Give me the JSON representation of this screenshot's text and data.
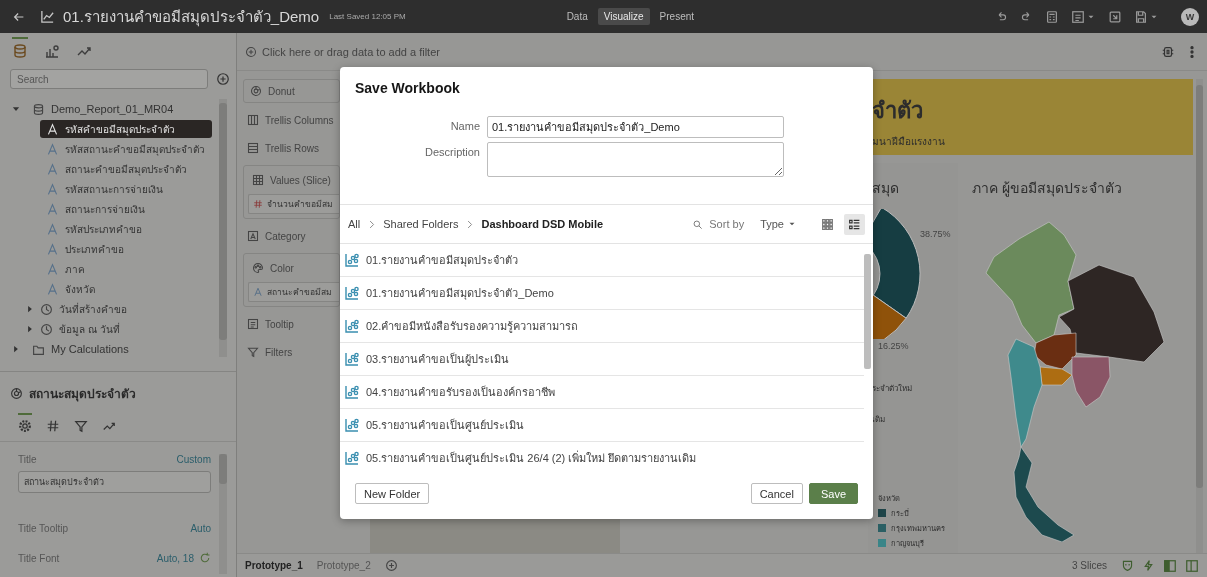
{
  "app_bar": {
    "title": "01.รายงานคำขอมีสมุดประจำตัว_Demo",
    "last_saved": "Last Saved 12:05 PM",
    "modes": [
      {
        "label": "Data",
        "selected": false
      },
      {
        "label": "Visualize",
        "selected": true
      },
      {
        "label": "Present",
        "selected": false
      }
    ],
    "avatar": "W"
  },
  "data_panel": {
    "tabs": [
      {
        "kind": "data",
        "selected": true
      },
      {
        "kind": "visualizations",
        "selected": false
      },
      {
        "kind": "analytics",
        "selected": false
      }
    ],
    "search": {
      "placeholder": "Search"
    },
    "tree": [
      {
        "label": "Demo_Report_01_MR04",
        "kind": "dataset",
        "expanded": true,
        "selected": false,
        "children": [
          {
            "label": "รหัสคำขอมีสมุดประจำตัว",
            "kind": "attribute",
            "selected": true
          },
          {
            "label": "รหัสสถานะคำขอมีสมุดประจำตัว",
            "kind": "attribute",
            "selected": false
          },
          {
            "label": "สถานะคำขอมีสมุดประจำตัว",
            "kind": "attribute",
            "selected": false
          },
          {
            "label": "รหัสสถานะการจ่ายเงิน",
            "kind": "attribute",
            "selected": false
          },
          {
            "label": "สถานะการจ่ายเงิน",
            "kind": "attribute",
            "selected": false
          },
          {
            "label": "รหัสประเภทคำขอ",
            "kind": "attribute",
            "selected": false
          },
          {
            "label": "ประเภทคำขอ",
            "kind": "attribute",
            "selected": false
          },
          {
            "label": "ภาค",
            "kind": "attribute",
            "selected": false
          },
          {
            "label": "จังหวัด",
            "kind": "attribute",
            "selected": false
          },
          {
            "label": "วันที่สร้างคำขอ",
            "kind": "date",
            "expanded": false,
            "selected": false
          },
          {
            "label": "ข้อมูล ณ วันที่",
            "kind": "date",
            "expanded": false,
            "selected": false
          }
        ]
      },
      {
        "label": "My Calculations",
        "kind": "folder",
        "expanded": false,
        "selected": false
      }
    ]
  },
  "properties": {
    "title": "สถานะสมุดประจำตัว",
    "tabs": [
      {
        "kind": "general",
        "selected": true
      },
      {
        "kind": "values",
        "selected": false
      },
      {
        "kind": "filters",
        "selected": false
      },
      {
        "kind": "analytics",
        "selected": false
      }
    ],
    "rows": [
      {
        "label": "Title",
        "value": "Custom",
        "kind": "field",
        "field_value": "สถานะสมุดประจำตัว"
      },
      {
        "label": "Title Tooltip",
        "value": "Auto",
        "kind": "plain"
      },
      {
        "label": "Title Font",
        "value": "Auto, 18",
        "kind": "reset"
      }
    ]
  },
  "filter_bar": {
    "placeholder": "Click here or drag data to add a filter"
  },
  "grammar": [
    {
      "label": "Donut",
      "kind": "chart_type"
    },
    {
      "label": "Trellis Columns",
      "kind": "trellis_columns"
    },
    {
      "label": "Trellis Rows",
      "kind": "trellis_rows"
    },
    {
      "label": "Values (Slice)",
      "kind": "values",
      "items": [
        {
          "label": "จำนวนคำขอมีสม",
          "kind": "measure"
        }
      ]
    },
    {
      "label": "Category",
      "kind": "category"
    },
    {
      "label": "Color",
      "kind": "color",
      "items": [
        {
          "label": "สถานะคำขอมีสม",
          "kind": "attribute"
        }
      ]
    },
    {
      "label": "Tooltip",
      "kind": "tooltip"
    },
    {
      "label": "Filters",
      "kind": "filters"
    }
  ],
  "canvas": {
    "banner": {
      "title": "จำตัว",
      "subtitle": "มนาฝีมือแรงงาน"
    },
    "donut_view": {
      "title": "สมุด",
      "slice_labels": [
        "38.75%",
        "16.25%"
      ],
      "legend": [
        "ระจำตัวใหม่",
        "เดิม"
      ]
    },
    "province_legend": {
      "title": "จังหวัด",
      "items": [
        {
          "label": "กระบี่",
          "color": "#1e4448"
        },
        {
          "label": "กรุงเทพมหานคร",
          "color": "#2b5f64"
        },
        {
          "label": "กาญจนบุรี",
          "color": "#3a8588"
        }
      ]
    },
    "map_view": {
      "title": "ภาค ผู้ขอมีสมุดประจำตัว"
    }
  },
  "bottom_bar": {
    "canvas_tabs": [
      {
        "label": "Prototype_1",
        "selected": true
      },
      {
        "label": "Prototype_2",
        "selected": false
      }
    ],
    "slices": "3 Slices"
  },
  "save_dialog": {
    "title": "Save Workbook",
    "name_label": "Name",
    "name_value": "01.รายงานคำขอมีสมุดประจำตัว_Demo",
    "description_label": "Description",
    "breadcrumb": [
      "All",
      "Shared Folders",
      "Dashboard DSD Mobile"
    ],
    "sort_label": "Sort by",
    "sort_value": "Type",
    "views": [
      {
        "kind": "grid",
        "selected": false
      },
      {
        "kind": "list",
        "selected": true
      }
    ],
    "items": [
      "01.รายงานคำขอมีสมุดประจำตัว",
      "01.รายงานคำขอมีสมุดประจำตัว_Demo",
      "02.คำขอมีหนังสือรับรองความรู้ความสามารถ",
      "03.รายงานคำขอเป็นผู้ประเมิน",
      "04.รายงานคำขอรับรองเป็นองค์กรอาชีพ",
      "05.รายงานคำขอเป็นศูนย์ประเมิน",
      "05.รายงานคำขอเป็นศูนย์ประเมิน 26/4 (2) เพิ่มใหม่ ยึดตามรายงานเดิม"
    ],
    "buttons": [
      {
        "label": "New Folder",
        "kind": "secondary"
      },
      {
        "label": "Cancel",
        "kind": "secondary"
      },
      {
        "label": "Save",
        "kind": "primary"
      }
    ]
  }
}
